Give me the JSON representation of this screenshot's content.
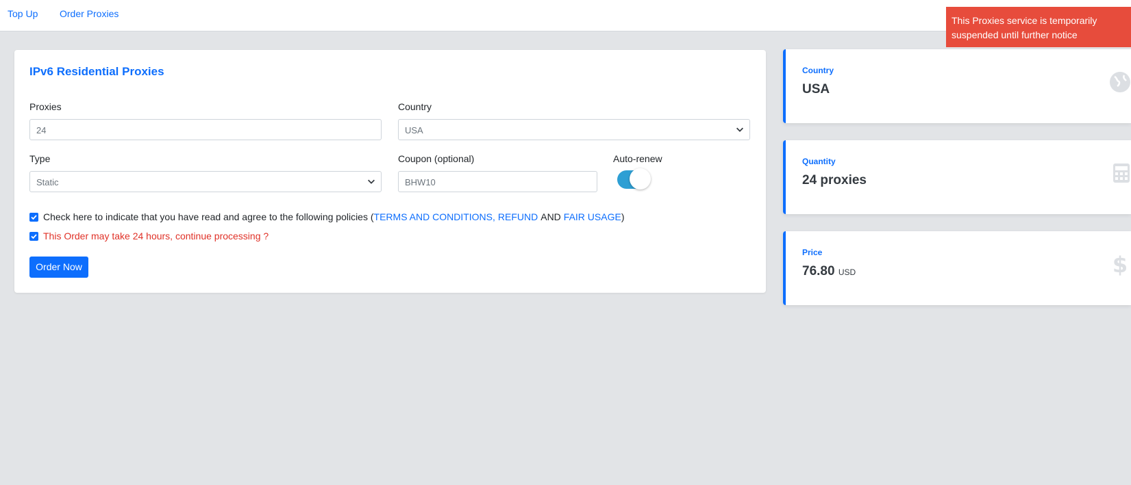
{
  "nav": {
    "items": [
      {
        "label": "Top Up"
      },
      {
        "label": "Order Proxies"
      }
    ]
  },
  "alert": {
    "message": "This Proxies service is temporarily suspended until further notice"
  },
  "order_form": {
    "title": "IPv6 Residential Proxies",
    "proxies": {
      "label": "Proxies",
      "value": "24"
    },
    "country": {
      "label": "Country",
      "value": "USA"
    },
    "type": {
      "label": "Type",
      "value": "Static"
    },
    "coupon": {
      "label": "Coupon (optional)",
      "value": "BHW10"
    },
    "auto_renew": {
      "label": "Auto-renew",
      "enabled": true
    },
    "policy_check": {
      "checked": true,
      "prefix": "Check here to indicate that you have read and agree to the following policies (",
      "terms": "TERMS AND CONDITIONS,",
      "refund": "REFUND",
      "and": "AND",
      "fair_usage": "FAIR USAGE",
      "suffix": ")"
    },
    "processing_check": {
      "checked": true,
      "text": "This Order may take 24 hours, continue processing ?"
    },
    "submit_label": "Order Now"
  },
  "summary": {
    "country": {
      "title": "Country",
      "value": "USA",
      "icon": "globe-icon"
    },
    "quantity": {
      "title": "Quantity",
      "value": "24 proxies",
      "icon": "calculator-icon"
    },
    "price": {
      "title": "Price",
      "value": "76.80",
      "unit": "USD",
      "icon": "dollar-icon"
    }
  },
  "colors": {
    "accent": "#0d6efd",
    "alert": "#e74c3c",
    "warning_text": "#e03127",
    "toggle_on": "#2e9fd4"
  }
}
